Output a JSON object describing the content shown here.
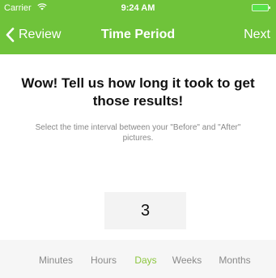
{
  "status_bar": {
    "carrier": "Carrier",
    "time": "9:24 AM",
    "wifi_icon": "wifi-icon",
    "battery_icon": "battery-icon"
  },
  "nav": {
    "back_label": "Review",
    "back_icon": "chevron-left-icon",
    "title": "Time Period",
    "next_label": "Next"
  },
  "content": {
    "headline": "Wow! Tell us how long it took to get those results!",
    "subtext": "Select the time interval between your \"Before\" and \"After\" pictures.",
    "value": "3"
  },
  "units": {
    "items": [
      "Minutes",
      "Hours",
      "Days",
      "Weeks",
      "Months"
    ],
    "selected": "Days"
  },
  "colors": {
    "accent": "#6fc33a",
    "selected_unit": "#8cc63f"
  }
}
